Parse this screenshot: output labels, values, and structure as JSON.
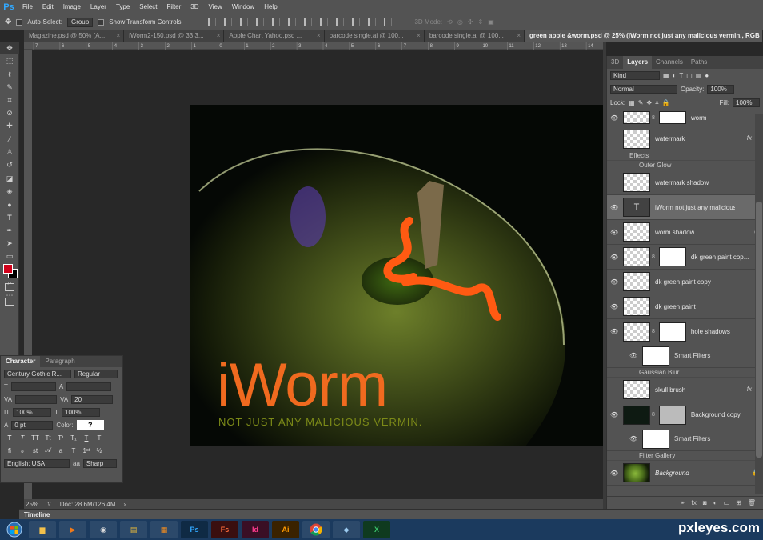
{
  "app": {
    "logo": "Ps"
  },
  "menu": [
    "File",
    "Edit",
    "Image",
    "Layer",
    "Type",
    "Select",
    "Filter",
    "3D",
    "View",
    "Window",
    "Help"
  ],
  "options": {
    "auto_select_label": "Auto-Select:",
    "auto_select_value": "Group",
    "transform_label": "Show Transform Controls",
    "mode_3d": "3D Mode:"
  },
  "doc_tabs": [
    "Magazine.psd @ 50% (A...",
    "iWorm2-150.psd @ 33.3...",
    "Apple Chart Yahoo.psd ...",
    "barcode single.ai @ 100...",
    "barcode single.ai @ 100...",
    "green apple &worm.psd @ 25% (iWorm not just any malicious vermin., RGB"
  ],
  "ruler_marks": [
    "7",
    "6",
    "5",
    "4",
    "3",
    "2",
    "1",
    "0",
    "1",
    "2",
    "3",
    "4",
    "5",
    "6",
    "7",
    "8",
    "9",
    "10",
    "11",
    "12",
    "13",
    "14"
  ],
  "artwork": {
    "title": "iWorm",
    "subtitle": "NOT JUST ANY MALICIOUS VERMIN."
  },
  "status": {
    "zoom": "25%",
    "doc": "Doc: 28.6M/126.4M"
  },
  "timeline_label": "Timeline",
  "character": {
    "tabs": [
      "Character",
      "Paragraph"
    ],
    "font_family": "Century Gothic R...",
    "font_style": "Regular",
    "tracking": "20",
    "vert_scale": "100%",
    "horiz_scale": "100%",
    "baseline": "0 pt",
    "color_label": "Color:",
    "color_value": "?",
    "language": "English: USA",
    "aa_label": "aa",
    "antialias": "Sharp"
  },
  "layers_panel": {
    "tabs": [
      "3D",
      "Layers",
      "Channels",
      "Paths"
    ],
    "filter": "Kind",
    "blend_mode": "Normal",
    "opacity_label": "Opacity:",
    "opacity": "100%",
    "lock_label": "Lock:",
    "fill_label": "Fill:",
    "fill": "100%",
    "effects_label": "Effects",
    "outer_glow": "Outer Glow",
    "smart_filters": "Smart Filters",
    "gaussian_blur": "Gaussian Blur",
    "filter_gallery": "Filter Gallery",
    "text_glyph": "T",
    "fx_glyph": "fx",
    "layers": [
      "worm",
      "watermark",
      "watermark shadow",
      "iWorm not just any malicious v...",
      "worm shadow",
      "dk green paint cop...",
      "dk green paint copy",
      "dk green paint",
      "hole shadows",
      "skull brush",
      "Background copy",
      "Background"
    ]
  },
  "watermark": "pxleyes.com"
}
